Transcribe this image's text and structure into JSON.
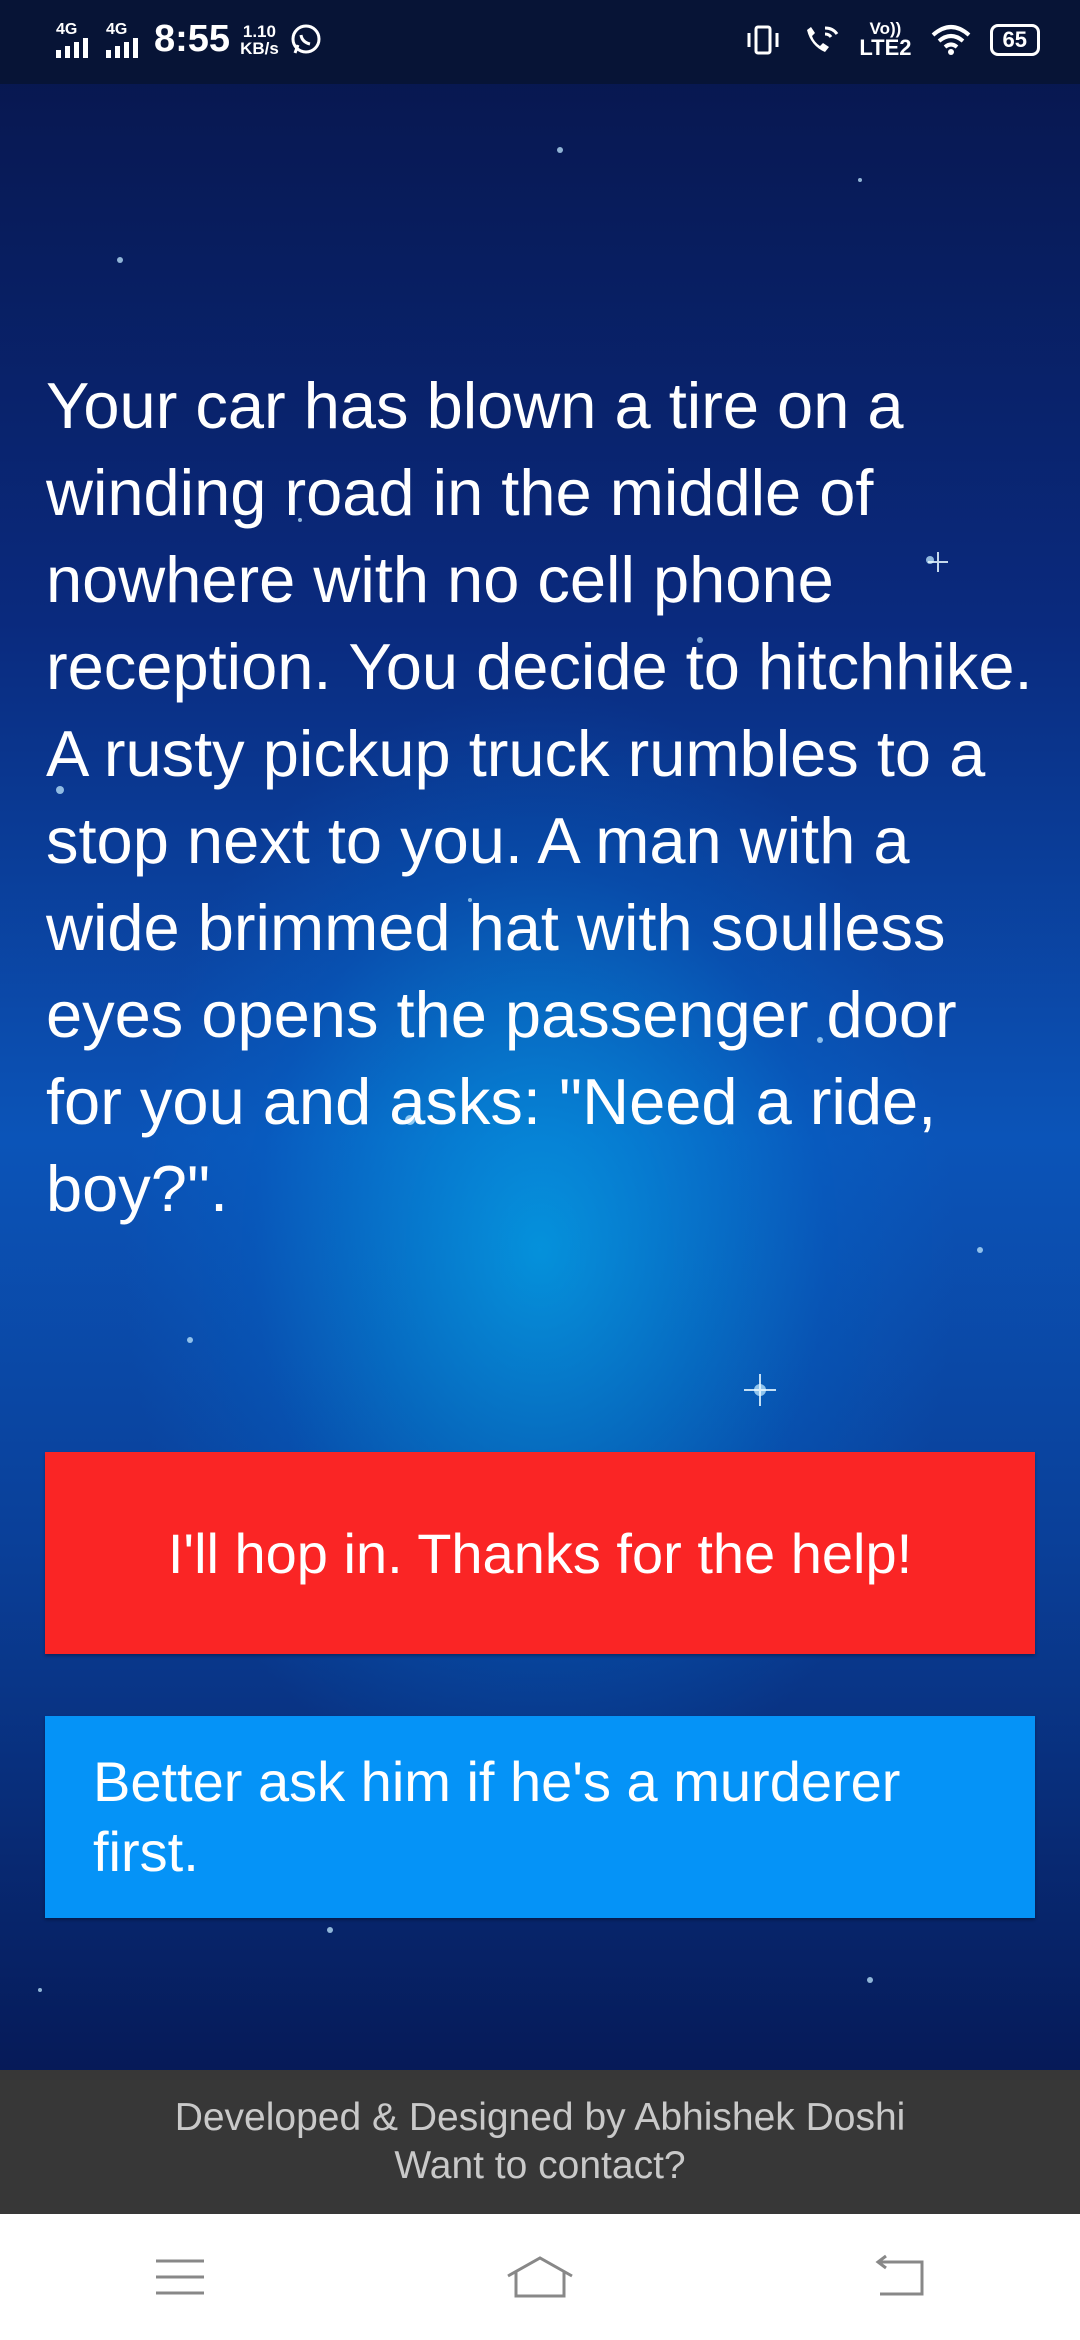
{
  "status_bar": {
    "network_1": "4G",
    "network_2": "4G",
    "time": "8:55",
    "speed_value": "1.10",
    "speed_unit": "KB/s",
    "volte": "Vo))",
    "lte": "LTE2",
    "battery": "65",
    "icons": [
      "whatsapp-icon",
      "vibrate-icon",
      "wifi-calling-icon",
      "wifi-icon",
      "battery-icon"
    ]
  },
  "story": {
    "text": "Your car has blown a tire on a winding road in the middle of nowhere with no cell phone reception. You decide to hitchhike. A rusty pickup truck rumbles to a stop next to you. A man with a wide brimmed hat with soulless eyes opens the passenger door for you and asks: \"Need a ride, boy?\"."
  },
  "choices": [
    {
      "label": "I'll hop in. Thanks for the help!",
      "color": "#fa2525"
    },
    {
      "label": "Better ask him if he's a murderer first.",
      "color": "#0593f7"
    }
  ],
  "footer": {
    "credit": "Developed & Designed by Abhishek Doshi",
    "contact": "Want to contact?"
  },
  "nav_bar": {
    "buttons": [
      "menu-icon",
      "home-icon",
      "back-icon"
    ]
  }
}
